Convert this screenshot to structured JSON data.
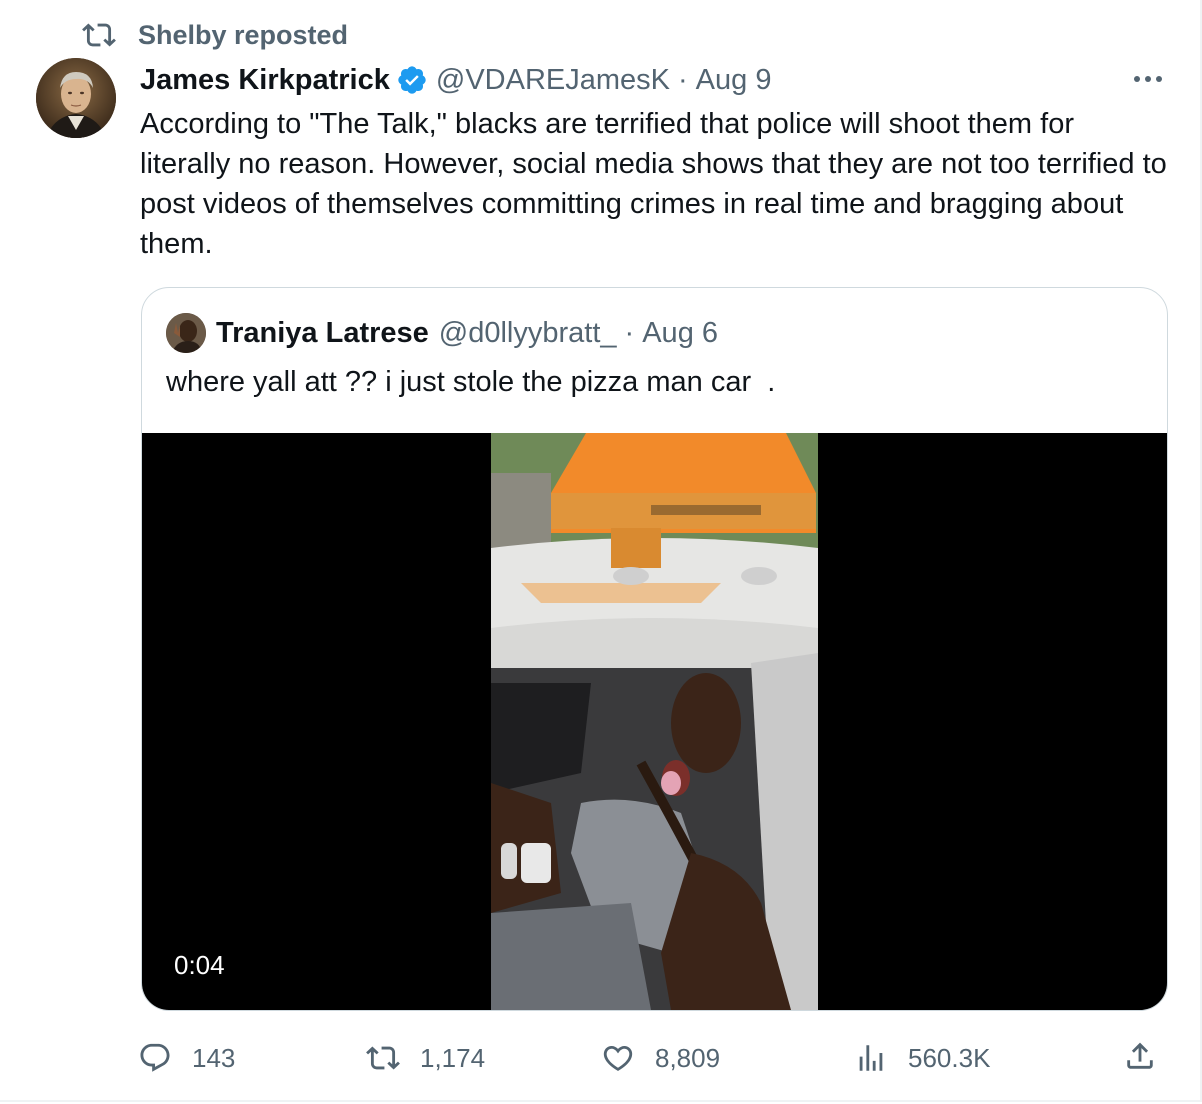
{
  "repost": {
    "label": "Shelby reposted",
    "icon": "repost-icon"
  },
  "tweet": {
    "author_name": "James Kirkpatrick",
    "verified": true,
    "handle": "@VDAREJamesK",
    "separator": "·",
    "date": "Aug 9",
    "text": "According to \"The Talk,\" blacks are terrified that police will shoot them for literally no reason. However, social media shows that they are not too terrified to post videos of themselves committing crimes in real time and bragging about them.",
    "more_icon": "more-icon"
  },
  "quote": {
    "author_name": "Traniya Latrese",
    "handle": "@d0llyybratt_",
    "separator": "·",
    "date": "Aug 6",
    "text": "where yall att ?? i just stole the pizza man car  .",
    "video_duration": "0:04"
  },
  "actions": {
    "replies": "143",
    "reposts": "1,174",
    "likes": "8,809",
    "views": "560.3K"
  },
  "colors": {
    "text": "#0f1419",
    "secondary": "#536471",
    "verified": "#1d9bf0",
    "border": "#cfd9de"
  }
}
